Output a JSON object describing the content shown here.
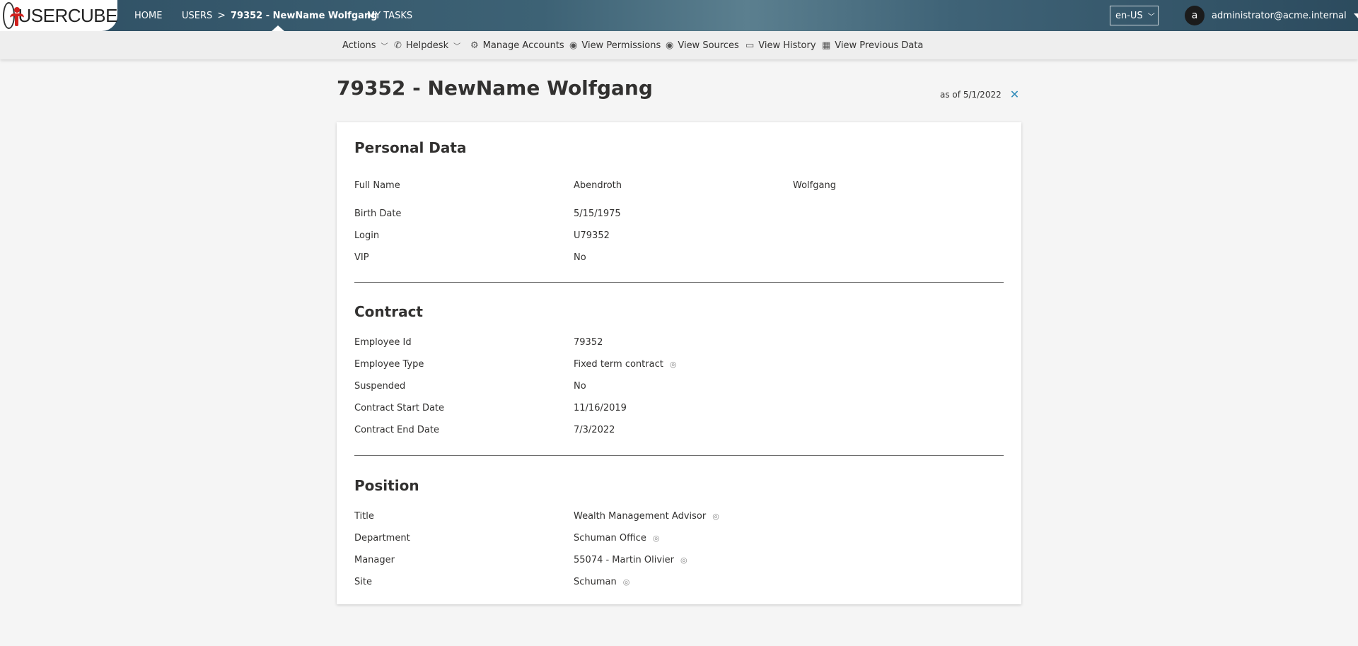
{
  "header": {
    "logo_text": "USERCUBE",
    "nav": {
      "home": "HOME",
      "users": "USERS",
      "breadcrumb_sep": ">",
      "current": "79352 - NewName Wolfgang",
      "tasks": "MY TASKS"
    },
    "language": "en-US",
    "user": {
      "avatar_letter": "a",
      "email": "administrator@acme.internal"
    }
  },
  "toolbar": {
    "actions": "Actions",
    "helpdesk": "Helpdesk",
    "manage_accounts": "Manage Accounts",
    "view_permissions": "View Permissions",
    "view_sources": "View Sources",
    "view_history": "View History",
    "view_previous_data": "View Previous Data"
  },
  "page": {
    "title": "79352 - NewName Wolfgang",
    "as_of_label": "as of",
    "as_of_date": "5/1/2022"
  },
  "personal": {
    "title": "Personal Data",
    "full_name_label": "Full Name",
    "last_name": "Abendroth",
    "first_name": "Wolfgang",
    "birth_label": "Birth Date",
    "birth": "5/15/1975",
    "login_label": "Login",
    "login": "U79352",
    "vip_label": "VIP",
    "vip": "No"
  },
  "contract": {
    "title": "Contract",
    "employee_id_label": "Employee Id",
    "employee_id": "79352",
    "employee_type_label": "Employee Type",
    "employee_type": "Fixed term contract",
    "suspended_label": "Suspended",
    "suspended": "No",
    "start_label": "Contract Start Date",
    "start": "11/16/2019",
    "end_label": "Contract End Date",
    "end": "7/3/2022"
  },
  "position": {
    "title": "Position",
    "title_label": "Title",
    "title_value": "Wealth Management Advisor",
    "department_label": "Department",
    "department": "Schuman Office",
    "manager_label": "Manager",
    "manager": "55074 - Martin Olivier",
    "site_label": "Site",
    "site": "Schuman"
  },
  "icons": {
    "eye": "eye-icon",
    "close": "close-icon",
    "gear": "gear-icon",
    "phone": "phone-icon",
    "calendar": "calendar-icon"
  },
  "colors": {
    "topbar": "#3d6275",
    "accent": "#2b88b8",
    "logo_red": "#d0201d"
  }
}
